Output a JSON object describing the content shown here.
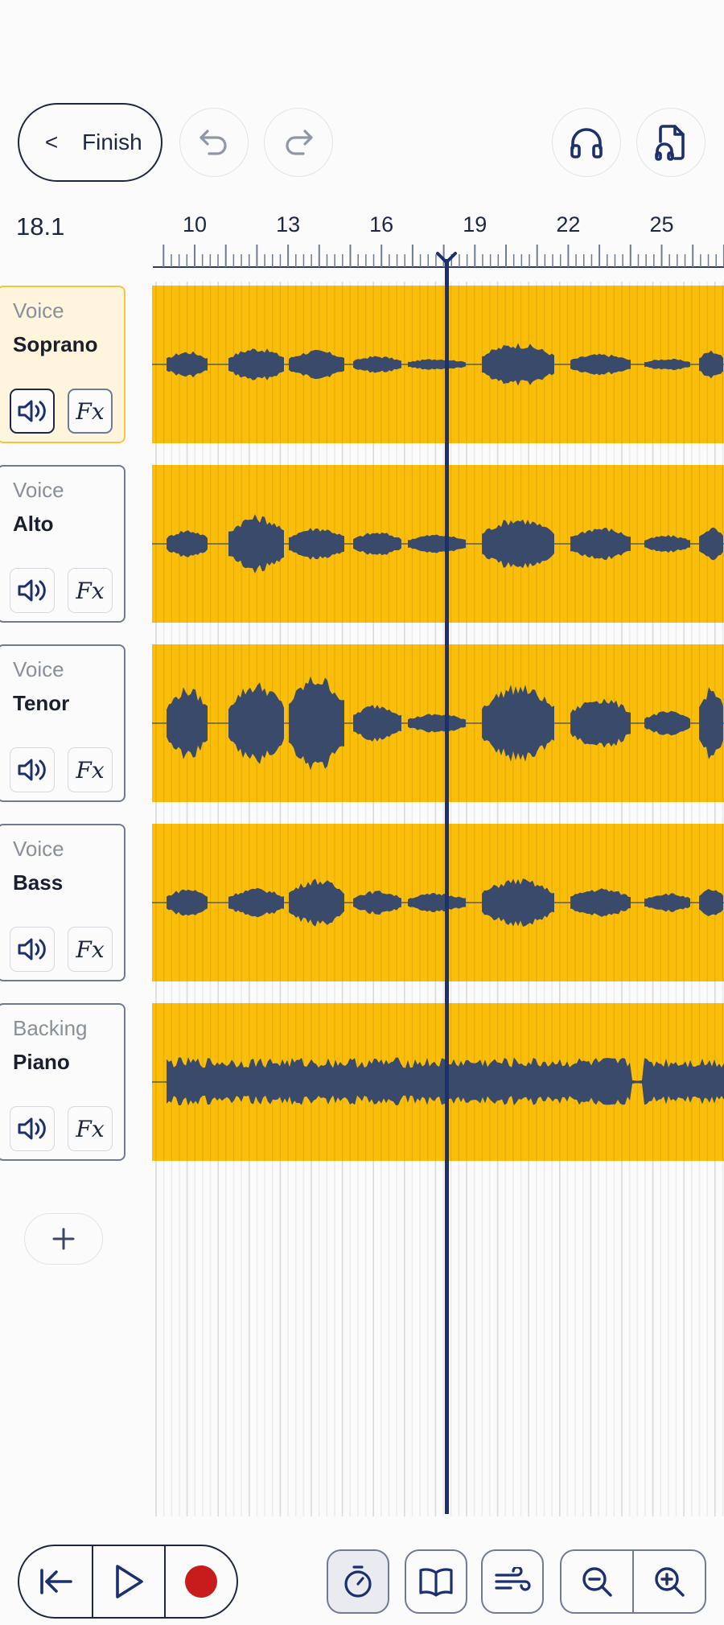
{
  "toolbar": {
    "finish_label": "Finish",
    "chevron": "<",
    "undo_icon": "undo-icon",
    "redo_icon": "redo-icon",
    "monitor_icon": "headphones-icon",
    "export_icon": "audio-file-icon"
  },
  "timeline": {
    "position_readout": "18.1",
    "tick_labels": [
      "10",
      "13",
      "16",
      "19",
      "22",
      "25"
    ],
    "playhead_position": 18.1
  },
  "tracks": [
    {
      "category": "Voice",
      "name": "Soprano",
      "selected": true,
      "fx_label": "Fx"
    },
    {
      "category": "Voice",
      "name": "Alto",
      "selected": false,
      "fx_label": "Fx"
    },
    {
      "category": "Voice",
      "name": "Tenor",
      "selected": false,
      "fx_label": "Fx"
    },
    {
      "category": "Voice",
      "name": "Bass",
      "selected": false,
      "fx_label": "Fx"
    },
    {
      "category": "Backing",
      "name": "Piano",
      "selected": false,
      "fx_label": "Fx"
    }
  ],
  "add_track_label": "+",
  "bottom_bar": {
    "transport": [
      "skip-to-start-icon",
      "play-icon",
      "record-icon"
    ],
    "tools": [
      "metronome-icon",
      "book-icon",
      "wind-icon"
    ],
    "zoom": [
      "zoom-out-icon",
      "zoom-in-icon"
    ]
  },
  "colors": {
    "clip": "#f9bd0a",
    "waveform": "#3a4a6a",
    "playhead": "#1c2f6e",
    "record": "#c81b1b",
    "accent": "#1d2742"
  }
}
